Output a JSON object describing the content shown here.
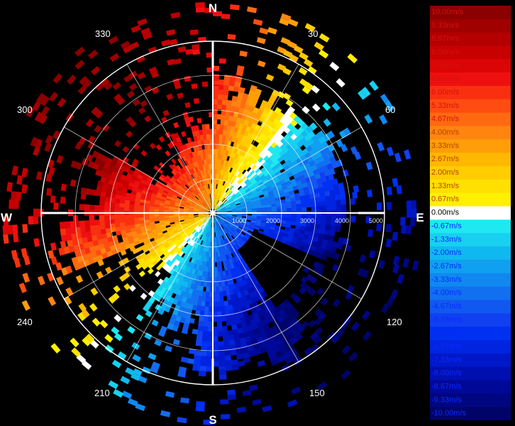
{
  "radar": {
    "cardinals": {
      "north": "N",
      "south": "S",
      "east": "E",
      "west": "W"
    },
    "azimuth_labels": [
      "30",
      "60",
      "120",
      "150",
      "210",
      "240",
      "300",
      "330"
    ],
    "range_labels": [
      "1000",
      "2000",
      "3000",
      "4000",
      "5000"
    ],
    "colors": {
      "background": "#000000",
      "grid": "#ffffff",
      "center": "#ffffff"
    }
  },
  "colorbar": {
    "entries": [
      {
        "label": "10.00m/s",
        "color": "#8b0000"
      },
      {
        "label": "9.33m/s",
        "color": "#a00000"
      },
      {
        "label": "8.67m/s",
        "color": "#b40000"
      },
      {
        "label": "8.00m/s",
        "color": "#c80000"
      },
      {
        "label": "7.33m/s",
        "color": "#dc0505"
      },
      {
        "label": "6.67m/s",
        "color": "#ee1010"
      },
      {
        "label": "6.00m/s",
        "color": "#f83010"
      },
      {
        "label": "5.33m/s",
        "color": "#ff4c10"
      },
      {
        "label": "4.67m/s",
        "color": "#ff6a10"
      },
      {
        "label": "4.00m/s",
        "color": "#ff8410"
      },
      {
        "label": "3.33m/s",
        "color": "#ff9e08"
      },
      {
        "label": "2.67m/s",
        "color": "#ffb800"
      },
      {
        "label": "2.00m/s",
        "color": "#ffcd00"
      },
      {
        "label": "1.33m/s",
        "color": "#ffe000"
      },
      {
        "label": "0.67m/s",
        "color": "#fff000"
      },
      {
        "label": "0.00m/s",
        "color": "#ffffff"
      },
      {
        "label": "-0.67m/s",
        "color": "#20e8f0"
      },
      {
        "label": "-1.33m/s",
        "color": "#18d0f0"
      },
      {
        "label": "-2.00m/s",
        "color": "#10b8f0"
      },
      {
        "label": "-2.67m/s",
        "color": "#10a0f0"
      },
      {
        "label": "-3.33m/s",
        "color": "#1088f0"
      },
      {
        "label": "-4.00m/s",
        "color": "#1070f0"
      },
      {
        "label": "-4.67m/s",
        "color": "#1058f0"
      },
      {
        "label": "-5.33m/s",
        "color": "#1040f0"
      },
      {
        "label": "-6.00m/s",
        "color": "#0030f0"
      },
      {
        "label": "-6.67m/s",
        "color": "#0024e0"
      },
      {
        "label": "-7.33m/s",
        "color": "#0018c8"
      },
      {
        "label": "-8.00m/s",
        "color": "#0010b0"
      },
      {
        "label": "-8.67m/s",
        "color": "#000898"
      },
      {
        "label": "-9.33m/s",
        "color": "#000680"
      },
      {
        "label": "-10.00m/s",
        "color": "#000468"
      }
    ]
  }
}
